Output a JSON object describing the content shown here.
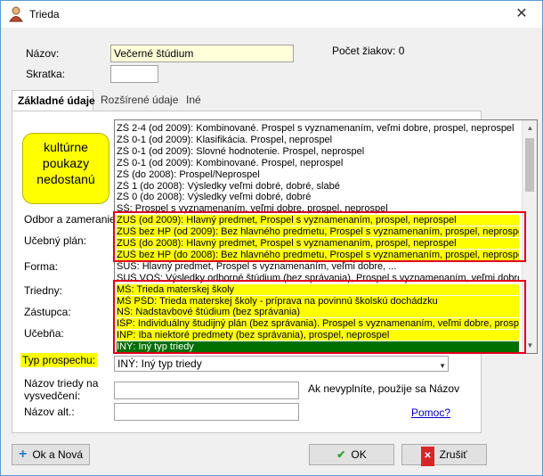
{
  "window": {
    "title": "Trieda"
  },
  "fields": {
    "nazov_label": "Názov:",
    "nazov_value": "Večerné štúdium",
    "skratka_label": "Skratka:",
    "skratka_value": "",
    "pocet_ziakov": "Počet žiakov: 0"
  },
  "tabs": [
    {
      "label": "Základné údaje"
    },
    {
      "label": "Rozšírené údaje"
    },
    {
      "label": "Iné"
    }
  ],
  "labels": {
    "odbor": "Odbor a zameranie:",
    "ucebny_plan": "Učebný plán:",
    "forma": "Forma:",
    "triedny": "Triedny:",
    "zastupca": "Zástupca:",
    "ucebna": "Učebňa:",
    "typ_prospechu": "Typ prospechu:",
    "nazov_triedy": "Názov triedy na vysvedčení:",
    "nazov_alt": "Názov alt.:",
    "hint": "Ak nevyplníte, použije sa Názov",
    "pomoc": "Pomoc?"
  },
  "callout": {
    "text": "kultúrne poukazy nedostanú"
  },
  "dropdown": {
    "items": [
      "ZŠ 2-4 (od 2009): Kombinované. Prospel s vyznamenaním, veľmi dobre, prospel, neprospel",
      "ZŠ 0-1 (od 2009): Klasifikácia. Prospel, neprospel",
      "ZŠ 0-1 (od 2009): Slovné hodnotenie. Prospel, neprospel",
      "ZŠ 0-1 (od 2009): Kombinované. Prospel, neprospel",
      "ZŠ (do 2008): Prospel/Neprospel",
      "ZŠ 1 (do 2008): Výsledky veľmi dobré, dobré, slabé",
      "ZŠ 0 (do 2008): Výsledky veľmi dobré, dobré",
      "SŠ: Prospel s vyznamenaním, veľmi dobre, prospel, neprospel",
      "ZUŠ (od 2009): Hlavný predmet, Prospel s vyznamenaním, prospel, neprospel",
      "ZUŠ bez HP (od 2009): Bez hlavného predmetu, Prospel s vyznamenaním, prospel, neprospel",
      "ZUŠ (do 2008): Hlavný predmet, Prospel s vyznamenaním, prospel, neprospel",
      "ZUŠ bez HP (do 2008): Bez hlavného predmetu, Prospel s vyznamenaním, prospel, neprospel",
      "SUŠ: Hlavný predmet, Prospel s vyznamenaním, veľmi dobre, ...",
      "SUŠ VOŠ: Výsledky odborné štúdium (bez správania), Prospel s vyznamenaním, veľmi dobre, ...",
      "MŠ: Trieda materskej školy",
      "MŠ PŠD: Trieda materskej školy - príprava na povinnú školskú dochádzku",
      "NŠ: Nadstavbové štúdium (bez správania)",
      "IŠP: Individuálny študijný plán (bez správania). Prospel s vyznamenaním, veľmi dobre, prospel, neprospel",
      "INP: Iba niektoré predmety (bez správania), prospel, neprospel",
      "INÝ: Iný typ triedy"
    ],
    "highlighted": [
      8,
      9,
      10,
      11,
      14,
      15,
      16,
      17,
      18
    ],
    "selected": 19
  },
  "combo": {
    "value": "INÝ: Iný typ triedy"
  },
  "buttons": {
    "ok_nova": "Ok a Nová",
    "ok": "OK",
    "zrusit": "Zrušiť"
  }
}
